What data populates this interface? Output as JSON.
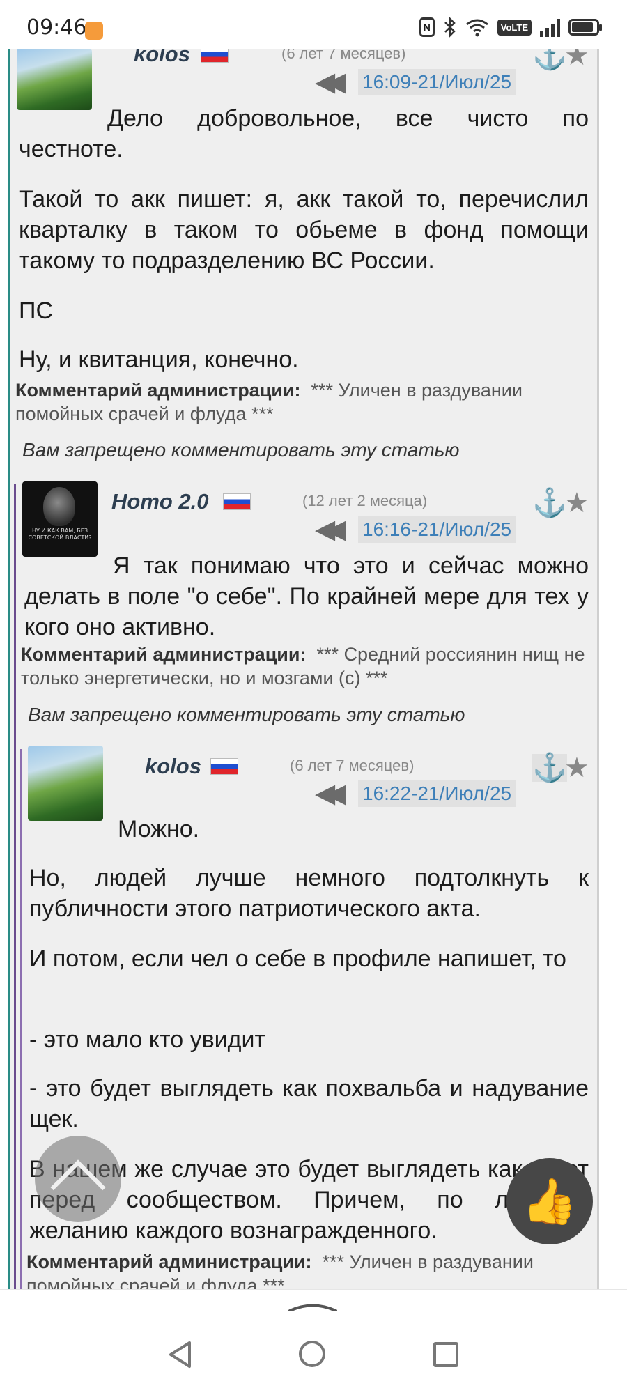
{
  "status_bar": {
    "time": "09:46",
    "volte": "VoLTE"
  },
  "comments": [
    {
      "username": "kolos",
      "age": "(6 лет 7 месяцев)",
      "timestamp": "16:09-21/Июл/25",
      "paragraphs": [
        "Дело добровольное, все чисто по честноте.",
        "Такой то акк пишет: я, акк такой то, перечислил кварталку в таком то обьеме в фонд помощи такому то подразделению ВС России.",
        "ПС",
        "Ну, и квитанция, конечно."
      ],
      "admin_label": "Комментарий администрации:",
      "admin_text": "*** Уличен в раздувании помойных срачей и флуда ***",
      "denied": "Вам запрещено комментировать эту статью"
    },
    {
      "username": "Homo 2.0",
      "age": "(12 лет 2 месяца)",
      "timestamp": "16:16-21/Июл/25",
      "avatar_caption": "НУ И КАК ВАМ, БЕЗ СОВЕТСКОЙ ВЛАСТИ?",
      "paragraphs": [
        "Я так понимаю что это  и сейчас можно делать в поле \"о себе\". По крайней мере для тех у кого оно активно."
      ],
      "admin_label": "Комментарий администрации:",
      "admin_text": "*** Средний россиянин нищ не только энергетически, но и мозгами (с) ***",
      "denied": "Вам запрещено комментировать эту статью"
    },
    {
      "username": "kolos",
      "age": "(6 лет 7 месяцев)",
      "timestamp": "16:22-21/Июл/25",
      "paragraphs": [
        "Можно.",
        "Но, людей лучше немного подтолкнуть к публичности этого патриотического акта.",
        "И потом, если чел о себе в профиле напишет, то",
        "- это мало кто увидит",
        "- это будет выглядеть как похвальба и надувание щек.",
        "В нашем же случае это будет выглядеть как отчет перед сообществом. Причем, по личному желанию каждого вознагражденного."
      ],
      "admin_label": "Комментарий администрации:",
      "admin_text": "*** Уличен в раздувании помойных срачей и флуда ***"
    }
  ],
  "icons": {
    "anchor": "⚓",
    "star": "★",
    "rewind": "◀◀",
    "like": "👍"
  },
  "colors": {
    "timestamp": "#3d7fb8",
    "username": "#2d3e50",
    "online": "#2bb24c",
    "panel_bg": "#efefef"
  }
}
